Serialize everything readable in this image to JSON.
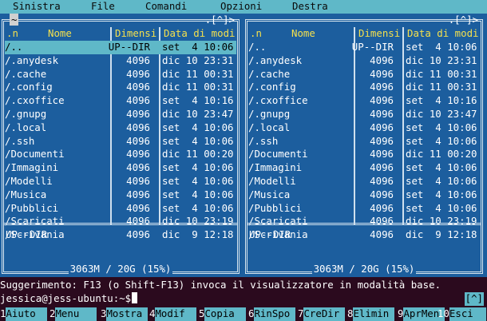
{
  "menu": {
    "items": [
      "Sinistra",
      "File",
      "Comandi",
      "Opzioni",
      "Destra"
    ]
  },
  "left_panel": {
    "path": "~",
    "corner": ".[^]>",
    "headers": {
      "name_marker": ".n",
      "name": "Nome",
      "size": "Dimensi",
      "date": "Data di modi"
    },
    "rows": [
      {
        "name": "/..",
        "size": "UP--DIR",
        "date": "set  4 10:06",
        "selected": true
      },
      {
        "name": "/.anydesk",
        "size": "4096",
        "date": "dic 10 23:31"
      },
      {
        "name": "/.cache",
        "size": "4096",
        "date": "dic 11 00:31"
      },
      {
        "name": "/.config",
        "size": "4096",
        "date": "dic 11 00:31"
      },
      {
        "name": "/.cxoffice",
        "size": "4096",
        "date": "set  4 10:16"
      },
      {
        "name": "/.gnupg",
        "size": "4096",
        "date": "dic 10 23:47"
      },
      {
        "name": "/.local",
        "size": "4096",
        "date": "set  4 10:06"
      },
      {
        "name": "/.ssh",
        "size": "4096",
        "date": "set  4 10:06"
      },
      {
        "name": "/Documenti",
        "size": "4096",
        "date": "dic 11 00:20"
      },
      {
        "name": "/Immagini",
        "size": "4096",
        "date": "set  4 10:06"
      },
      {
        "name": "/Modelli",
        "size": "4096",
        "date": "set  4 10:06"
      },
      {
        "name": "/Musica",
        "size": "4096",
        "date": "set  4 10:06"
      },
      {
        "name": "/Pubblici",
        "size": "4096",
        "date": "set  4 10:06"
      },
      {
        "name": "/Scaricati",
        "size": "4096",
        "date": "dic 10 23:19"
      },
      {
        "name": "/Scrivania",
        "size": "4096",
        "date": "dic  9 12:18"
      }
    ],
    "status": "UP--DIR",
    "footer": "3063M / 20G (15%)"
  },
  "right_panel": {
    "path": "",
    "corner": ".[^]>",
    "headers": {
      "name_marker": ".n",
      "name": "Nome",
      "size": "Dimensi",
      "date": "Data di modi"
    },
    "rows": [
      {
        "name": "/..",
        "size": "UP--DIR",
        "date": "set  4 10:06"
      },
      {
        "name": "/.anydesk",
        "size": "4096",
        "date": "dic 10 23:31"
      },
      {
        "name": "/.cache",
        "size": "4096",
        "date": "dic 11 00:31"
      },
      {
        "name": "/.config",
        "size": "4096",
        "date": "dic 11 00:31"
      },
      {
        "name": "/.cxoffice",
        "size": "4096",
        "date": "set  4 10:16"
      },
      {
        "name": "/.gnupg",
        "size": "4096",
        "date": "dic 10 23:47"
      },
      {
        "name": "/.local",
        "size": "4096",
        "date": "set  4 10:06"
      },
      {
        "name": "/.ssh",
        "size": "4096",
        "date": "set  4 10:06"
      },
      {
        "name": "/Documenti",
        "size": "4096",
        "date": "dic 11 00:20"
      },
      {
        "name": "/Immagini",
        "size": "4096",
        "date": "set  4 10:06"
      },
      {
        "name": "/Modelli",
        "size": "4096",
        "date": "set  4 10:06"
      },
      {
        "name": "/Musica",
        "size": "4096",
        "date": "set  4 10:06"
      },
      {
        "name": "/Pubblici",
        "size": "4096",
        "date": "set  4 10:06"
      },
      {
        "name": "/Scaricati",
        "size": "4096",
        "date": "dic 10 23:19"
      },
      {
        "name": "/Scrivania",
        "size": "4096",
        "date": "dic  9 12:18"
      }
    ],
    "status": "UP--DIR",
    "footer": "3063M / 20G (15%)"
  },
  "hint": "Suggerimento: F13 (o Shift-F13) invoca il visualizzatore in modalità base.",
  "prompt": "jessica@jess-ubuntu:~$",
  "prompt_corner": "[^]",
  "fkeys": [
    {
      "num": "1",
      "label": "Aiuto"
    },
    {
      "num": "2",
      "label": "Menu"
    },
    {
      "num": "3",
      "label": "Mostra"
    },
    {
      "num": "4",
      "label": "Modif"
    },
    {
      "num": "5",
      "label": "Copia"
    },
    {
      "num": "6",
      "label": "RinSpo"
    },
    {
      "num": "7",
      "label": "CreDir"
    },
    {
      "num": "8",
      "label": "Elimin"
    },
    {
      "num": "9",
      "label": "AprMen"
    },
    {
      "num": "10",
      "label": "Esci"
    }
  ],
  "colors": {
    "panel_bg": "#1c5e9e",
    "accent_cyan": "#5fb8c8",
    "header_yellow": "#f4e04d",
    "terminal_bg": "#2b0a1e"
  }
}
